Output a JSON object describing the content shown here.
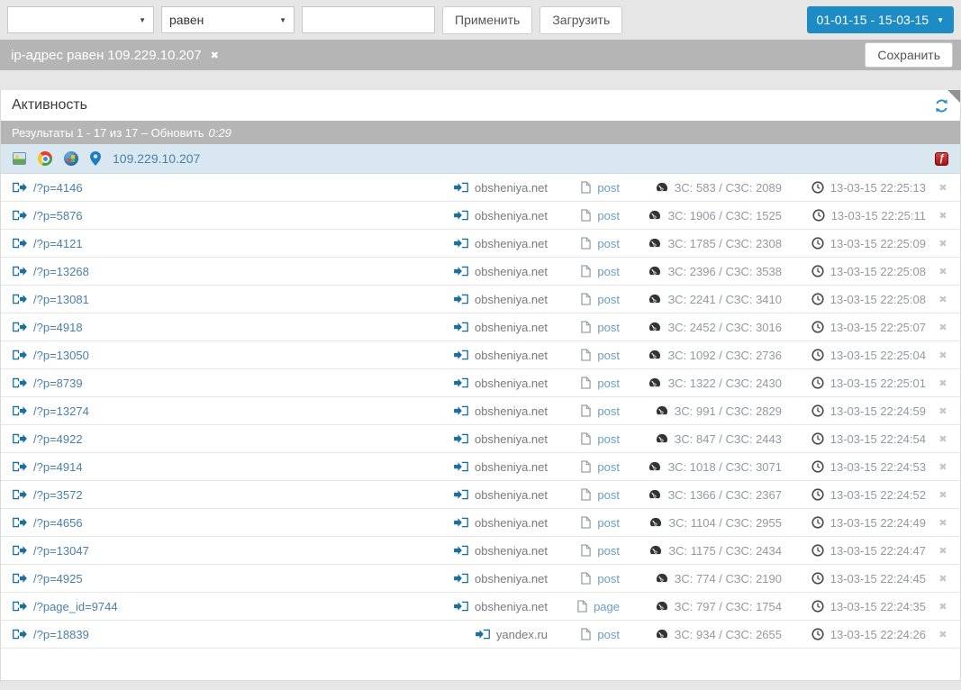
{
  "toolbar": {
    "field_select": {
      "value": ""
    },
    "operator_select": {
      "value": "равен"
    },
    "value_input": {
      "value": "",
      "placeholder": ""
    },
    "apply_label": "Применить",
    "load_label": "Загрузить",
    "date_range_label": "01-01-15 - 15-03-15"
  },
  "filter_bar": {
    "filter_text": "ip-адрес равен 109.229.10.207",
    "remove_icon": "✖",
    "save_label": "Сохранить"
  },
  "panel": {
    "title": "Активность",
    "results_text": "Результаты 1 - 17 из 17 – Обновить",
    "refresh_countdown": "0:29",
    "visitor": {
      "ip": "109.229.10.207",
      "icons": [
        "image-icon",
        "chrome-browser-icon",
        "windows-os-icon",
        "location-pin-icon",
        "flash-icon"
      ],
      "flash_glyph": "ƒ"
    },
    "rows": [
      {
        "page": "/?p=4146",
        "referrer": "obsheniya.net",
        "type": "post",
        "load_stats": "ЗС: 583 / СЗС: 2089",
        "time": "13-03-15 22:25:13"
      },
      {
        "page": "/?p=5876",
        "referrer": "obsheniya.net",
        "type": "post",
        "load_stats": "ЗС: 1906 / СЗС: 1525",
        "time": "13-03-15 22:25:11"
      },
      {
        "page": "/?p=4121",
        "referrer": "obsheniya.net",
        "type": "post",
        "load_stats": "ЗС: 1785 / СЗС: 2308",
        "time": "13-03-15 22:25:09"
      },
      {
        "page": "/?p=13268",
        "referrer": "obsheniya.net",
        "type": "post",
        "load_stats": "ЗС: 2396 / СЗС: 3538",
        "time": "13-03-15 22:25:08"
      },
      {
        "page": "/?p=13081",
        "referrer": "obsheniya.net",
        "type": "post",
        "load_stats": "ЗС: 2241 / СЗС: 3410",
        "time": "13-03-15 22:25:08"
      },
      {
        "page": "/?p=4918",
        "referrer": "obsheniya.net",
        "type": "post",
        "load_stats": "ЗС: 2452 / СЗС: 3016",
        "time": "13-03-15 22:25:07"
      },
      {
        "page": "/?p=13050",
        "referrer": "obsheniya.net",
        "type": "post",
        "load_stats": "ЗС: 1092 / СЗС: 2736",
        "time": "13-03-15 22:25:04"
      },
      {
        "page": "/?p=8739",
        "referrer": "obsheniya.net",
        "type": "post",
        "load_stats": "ЗС: 1322 / СЗС: 2430",
        "time": "13-03-15 22:25:01"
      },
      {
        "page": "/?p=13274",
        "referrer": "obsheniya.net",
        "type": "post",
        "load_stats": "ЗС: 991 / СЗС: 2829",
        "time": "13-03-15 22:24:59"
      },
      {
        "page": "/?p=4922",
        "referrer": "obsheniya.net",
        "type": "post",
        "load_stats": "ЗС: 847 / СЗС: 2443",
        "time": "13-03-15 22:24:54"
      },
      {
        "page": "/?p=4914",
        "referrer": "obsheniya.net",
        "type": "post",
        "load_stats": "ЗС: 1018 / СЗС: 3071",
        "time": "13-03-15 22:24:53"
      },
      {
        "page": "/?p=3572",
        "referrer": "obsheniya.net",
        "type": "post",
        "load_stats": "ЗС: 1366 / СЗС: 2367",
        "time": "13-03-15 22:24:52"
      },
      {
        "page": "/?p=4656",
        "referrer": "obsheniya.net",
        "type": "post",
        "load_stats": "ЗС: 1104 / СЗС: 2955",
        "time": "13-03-15 22:24:49"
      },
      {
        "page": "/?p=13047",
        "referrer": "obsheniya.net",
        "type": "post",
        "load_stats": "ЗС: 1175 / СЗС: 2434",
        "time": "13-03-15 22:24:47"
      },
      {
        "page": "/?p=4925",
        "referrer": "obsheniya.net",
        "type": "post",
        "load_stats": "ЗС: 774 / СЗС: 2190",
        "time": "13-03-15 22:24:45"
      },
      {
        "page": "/?page_id=9744",
        "referrer": "obsheniya.net",
        "type": "page",
        "load_stats": "ЗС: 797 / СЗС: 1754",
        "time": "13-03-15 22:24:35"
      },
      {
        "page": "/?p=18839",
        "referrer": "yandex.ru",
        "type": "post",
        "load_stats": "ЗС: 934 / СЗС: 2655",
        "time": "13-03-15 22:24:26"
      }
    ]
  },
  "colors": {
    "accent_blue": "#1e8cc4",
    "bar_gray": "#b5b5b5",
    "visitor_row_bg": "#d9e7f1",
    "link_blue": "#4a80a8",
    "type_link_blue": "#6b9ec2",
    "muted_gray": "#94999e",
    "flash_red": "#b01212"
  }
}
